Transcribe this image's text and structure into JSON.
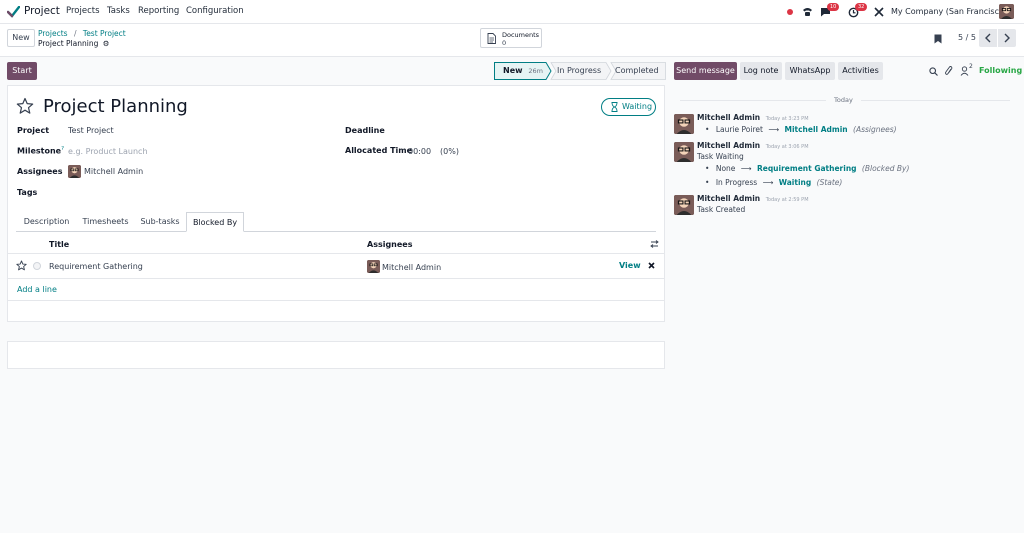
{
  "navbar": {
    "app_name": "Project",
    "menu": [
      "Projects",
      "Tasks",
      "Reporting",
      "Configuration"
    ],
    "chat_count": "10",
    "activity_count": "32",
    "company": "My Company (San Francisco)"
  },
  "control_panel": {
    "new_label": "New",
    "breadcrumb": [
      "Projects",
      "Test Project"
    ],
    "record_title": "Project Planning",
    "documents_label": "Documents",
    "documents_count": "0",
    "pager": "5 / 5"
  },
  "statusbar": {
    "start_label": "Start",
    "stages": [
      {
        "name": "New",
        "duration": "26m",
        "active": true
      },
      {
        "name": "In Progress"
      },
      {
        "name": "Completed"
      }
    ]
  },
  "form": {
    "title": "Project Planning",
    "state_badge": "Waiting",
    "fields": {
      "project_label": "Project",
      "project_value": "Test Project",
      "milestone_label": "Milestone",
      "milestone_help": "?",
      "milestone_placeholder": "e.g. Product Launch",
      "assignees_label": "Assignees",
      "assignees_value": "Mitchell Admin",
      "tags_label": "Tags",
      "deadline_label": "Deadline",
      "allocated_label": "Allocated Time",
      "allocated_value": "00:00",
      "allocated_percent": "(0%)"
    },
    "tabs": [
      "Description",
      "Timesheets",
      "Sub-tasks",
      "Blocked By"
    ],
    "active_tab": "Blocked By",
    "table": {
      "headers": [
        "Title",
        "Assignees"
      ],
      "rows": [
        {
          "title": "Requirement Gathering",
          "assignee": "Mitchell Admin",
          "action": "View"
        }
      ],
      "add_line": "Add a line"
    }
  },
  "chatter": {
    "buttons": [
      "Send message",
      "Log note",
      "WhatsApp",
      "Activities"
    ],
    "followers_count": "2",
    "following_label": "Following",
    "date_separator": "Today",
    "messages": [
      {
        "author": "Mitchell Admin",
        "time": "Today at 3:23 PM",
        "body": "",
        "tracking": [
          {
            "old": "Laurie Poiret",
            "new": "Mitchell Admin",
            "field": "(Assignees)"
          }
        ]
      },
      {
        "author": "Mitchell Admin",
        "time": "Today at 3:06 PM",
        "body": "Task Waiting",
        "tracking": [
          {
            "old": "None",
            "new": "Requirement Gathering",
            "field": "(Blocked By)"
          },
          {
            "old": "In Progress",
            "new": "Waiting",
            "field": "(State)"
          }
        ]
      },
      {
        "author": "Mitchell Admin",
        "time": "Today at 2:59 PM",
        "body": "Task Created",
        "tracking": []
      }
    ]
  },
  "colors": {
    "brand": "#714b67",
    "accent": "#017e84",
    "following": "#28a745",
    "badge": "#dc3545"
  }
}
